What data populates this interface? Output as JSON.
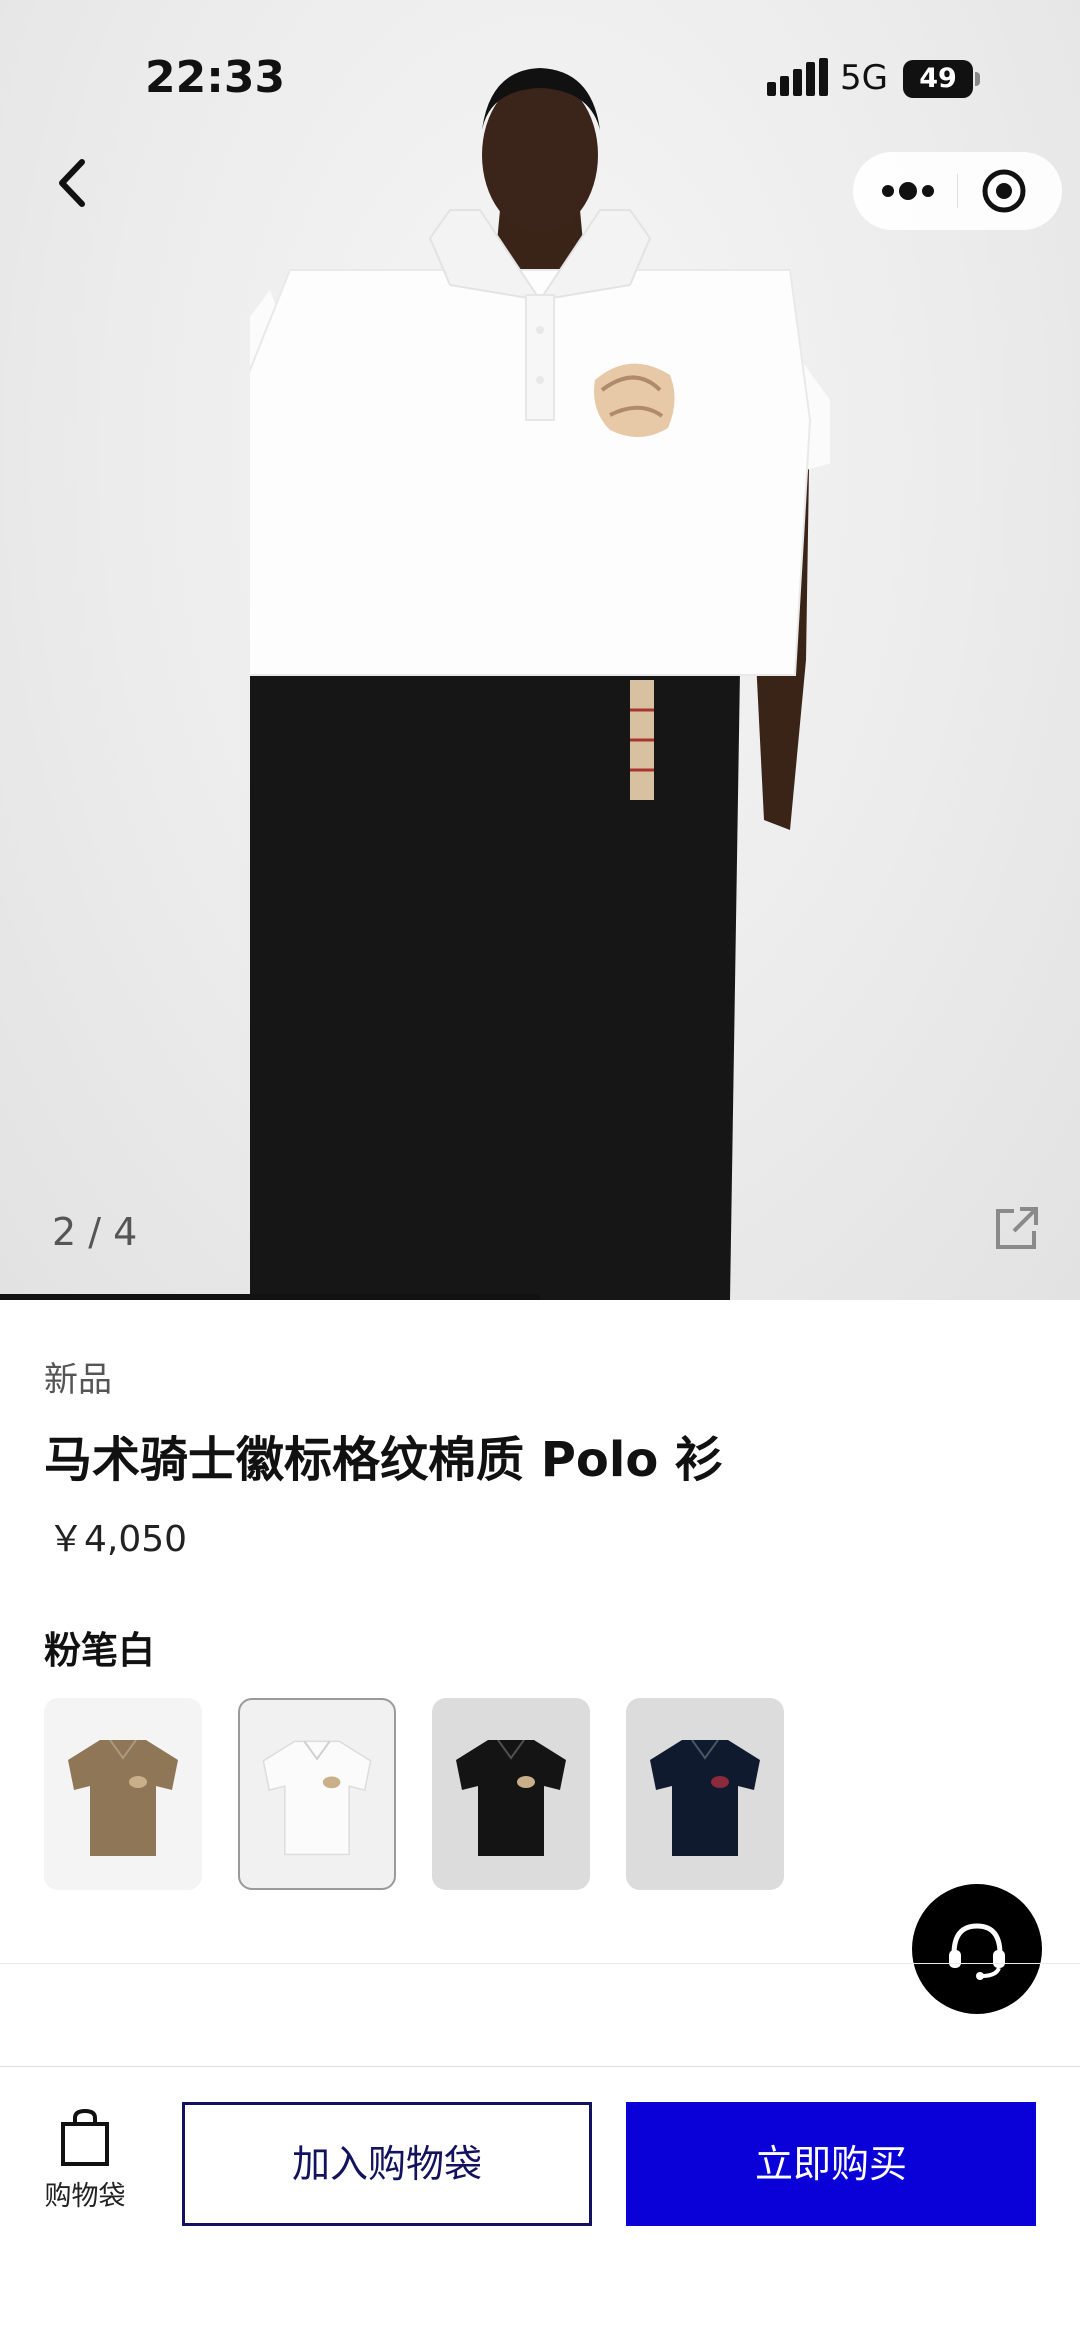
{
  "status_bar": {
    "time": "22:33",
    "network": "5G",
    "battery": "49"
  },
  "nav": {
    "back_icon": "chevron-left-icon",
    "more_icon": "more-dots-icon",
    "close_icon": "target-close-icon"
  },
  "gallery": {
    "counter": "2 / 4",
    "current": 2,
    "total": 4,
    "progress_fraction": 0.5,
    "share_icon": "share-icon"
  },
  "product": {
    "tag": "新品",
    "title": "马术骑士徽标格纹棉质 Polo 衫",
    "price": "￥4,050",
    "color_name": "粉笔白"
  },
  "swatches": [
    {
      "color": "#8e7656",
      "bg": "#f4f4f4",
      "selected": false
    },
    {
      "color": "#fbfbfb",
      "bg": "#f1f1f1",
      "selected": true
    },
    {
      "color": "#141414",
      "bg": "#dcdcdc",
      "selected": false
    },
    {
      "color": "#101a2e",
      "bg": "#dcdcdc",
      "selected": false
    }
  ],
  "support": {
    "icon": "headset-icon"
  },
  "bottom_bar": {
    "bag_icon": "shopping-bag-icon",
    "bag_label": "购物袋",
    "add_to_bag": "加入购物袋",
    "buy_now": "立即购买"
  },
  "colors": {
    "accent": "#0a00d8",
    "navy": "#13125e"
  }
}
